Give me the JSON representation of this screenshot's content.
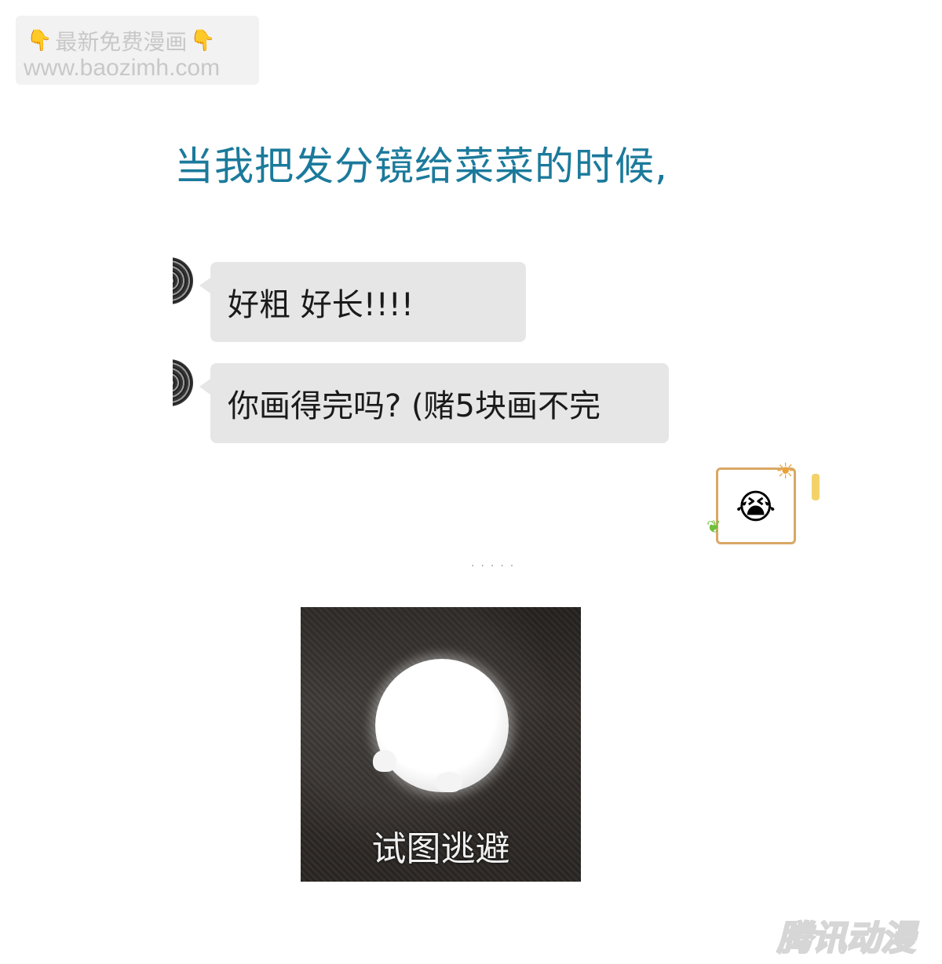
{
  "watermark": {
    "title": "最新免费漫画",
    "url": "www.baozimh.com"
  },
  "heading": "当我把发分镜给菜菜的时候,",
  "chat": {
    "messages": [
      {
        "text": "好粗 好长!!!!"
      },
      {
        "text": "你画得完吗?  (赌5块画不完"
      }
    ],
    "sticker_icon": "crying-face-icon"
  },
  "photo": {
    "caption": "试图逃避"
  },
  "brand": {
    "logo": "腾讯动漫"
  }
}
